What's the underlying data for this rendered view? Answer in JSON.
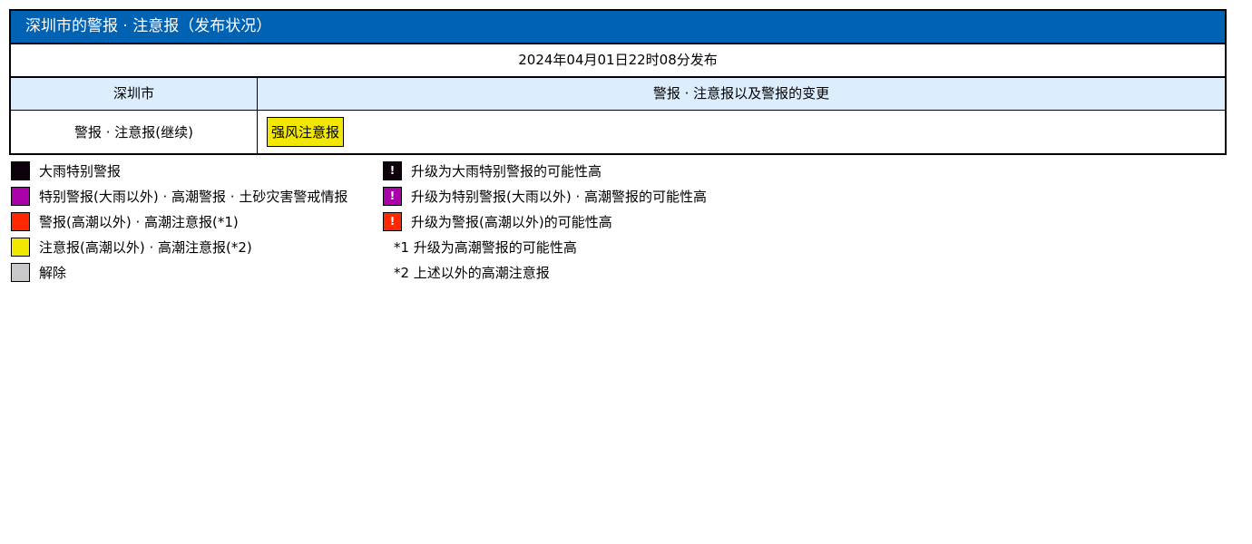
{
  "header": {
    "title": "深圳市的警报 · 注意报（发布状况）",
    "issued": "2024年04月01日22时08分发布"
  },
  "table": {
    "col_region": "深圳市",
    "col_alerts": "警报 · 注意报以及警报的变更",
    "row_label": "警报 · 注意报(继续)",
    "active_alert": {
      "label": "强风注意报",
      "color": "#f2e700"
    }
  },
  "legend": {
    "levels": [
      {
        "label": "大雨特别警报",
        "color": "#0c000c"
      },
      {
        "label": "特别警报(大雨以外) · 高潮警报 · 土砂灾害警戒情报",
        "color": "#aa00aa"
      },
      {
        "label": "警报(高潮以外) · 高潮注意报(*1)",
        "color": "#ff2800"
      },
      {
        "label": "注意报(高潮以外) · 高潮注意报(*2)",
        "color": "#f2e700"
      },
      {
        "label": "解除",
        "color": "#c8c8cb"
      }
    ],
    "possibility": [
      {
        "label": "升级为大雨特别警报的可能性高",
        "color": "#0c000c",
        "mark": "!"
      },
      {
        "label": "升级为特别警报(大雨以外) · 高潮警报的可能性高",
        "color": "#aa00aa",
        "mark": "!"
      },
      {
        "label": "升级为警报(高潮以外)的可能性高",
        "color": "#ff2800",
        "mark": "!"
      }
    ],
    "notes": [
      "*1 升级为高潮警报的可能性高",
      "*2 上述以外的高潮注意报"
    ]
  }
}
